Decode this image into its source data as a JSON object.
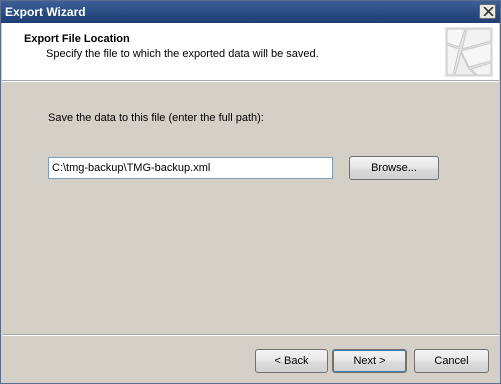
{
  "window": {
    "title": "Export Wizard",
    "close_icon": "close-icon"
  },
  "header": {
    "title": "Export File Location",
    "subtitle": "Specify the file to which the exported data will be saved.",
    "graphic_icon": "wizard-graphic-icon"
  },
  "main": {
    "prompt": "Save the data to this file (enter the full path):",
    "path_value": "C:\\tmg-backup\\TMG-backup.xml",
    "browse_label": "Browse..."
  },
  "footer": {
    "back_label": "< Back",
    "next_label": "Next >",
    "cancel_label": "Cancel"
  }
}
